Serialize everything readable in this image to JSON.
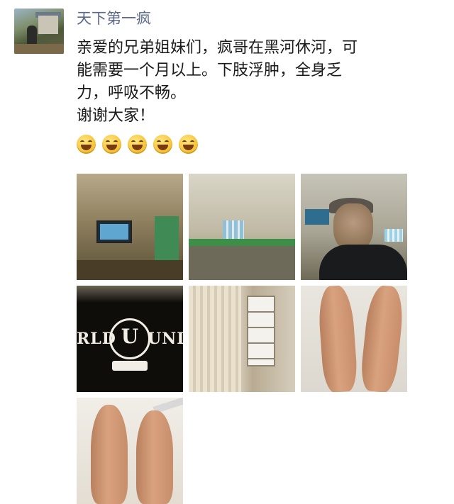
{
  "post": {
    "username": "天下第一疯",
    "text_lines": [
      "亲爱的兄弟姐妹们，疯哥在黑河休河，可",
      "能需要一个月以上。下肢浮肿，全身乏",
      "力，呼吸不畅。",
      "谢谢大家！"
    ],
    "emoji_count": 5
  },
  "photo_grid": {
    "tile4_sign_left": "RLD",
    "tile4_sign_right": "UNI",
    "tile4_logo_letter": "U"
  },
  "colors": {
    "username": "#5b6a8a",
    "text": "#1a1a1a"
  }
}
